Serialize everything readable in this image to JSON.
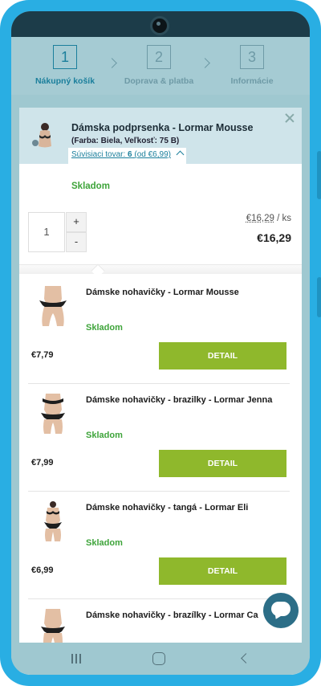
{
  "steps": [
    {
      "num": "1",
      "label": "Nákupný košík",
      "active": true
    },
    {
      "num": "2",
      "label": "Doprava & platba",
      "active": false
    },
    {
      "num": "3",
      "label": "Informácie",
      "active": false
    }
  ],
  "modal": {
    "product": {
      "title": "Dámska podprsenka - Lormar Mousse",
      "variant": "(Farba: Biela, Veľkosť: 75 B)",
      "related_label": "Súvisiaci tovar: ",
      "related_count": "6",
      "related_from": " (od €6,99)",
      "stock": "Skladom",
      "quantity": "1",
      "plus_label": "+",
      "minus_label": "-",
      "unit_price": "€16,29",
      "unit_suffix": " / ks",
      "total_price": "€16,29"
    },
    "related_items": [
      {
        "name": "Dámske nohavičky - Lormar Mousse",
        "stock": "Skladom",
        "price": "€7,79",
        "button": "DETAIL"
      },
      {
        "name": "Dámske nohavičky - brazilky - Lormar Jenna",
        "stock": "Skladom",
        "price": "€7,99",
        "button": "DETAIL"
      },
      {
        "name": "Dámske nohavičky - tangá - Lormar Eli",
        "stock": "Skladom",
        "price": "€6,99",
        "button": "DETAIL"
      },
      {
        "name": "Dámske nohavičky - brazílky - Lormar Ca",
        "stock": "",
        "price": "",
        "button": ""
      }
    ]
  },
  "colors": {
    "frame": "#29aee3",
    "accent": "#1b7f9c",
    "stock_green": "#3ea43a",
    "button_green": "#8fb82c"
  },
  "icons": [
    "close-icon",
    "chevron-up-icon",
    "chat-icon",
    "nav-recent-icon",
    "nav-home-icon",
    "nav-back-icon"
  ]
}
